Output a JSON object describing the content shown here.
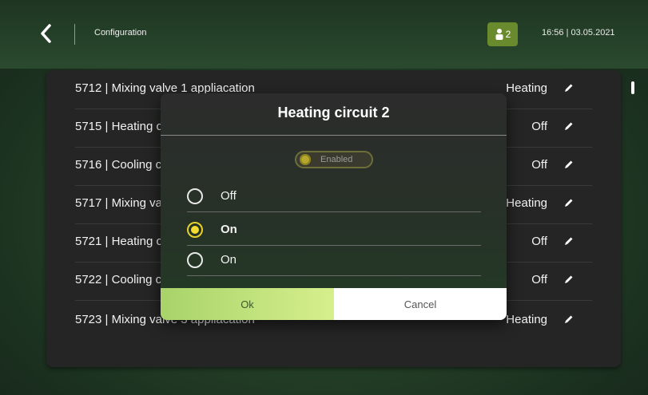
{
  "header": {
    "title": "Configuration",
    "user_count": "2",
    "datetime": "16:56 | 03.05.2021"
  },
  "list": {
    "rows": [
      {
        "label": "5712 | Mixing valve 1 appliacation",
        "value": "Heating"
      },
      {
        "label": "5715 | Heating circuit 2",
        "value": "Off"
      },
      {
        "label": "5716 | Cooling circuit 2",
        "value": "Off"
      },
      {
        "label": "5717 | Mixing valve 2 appliacation",
        "value": "Heating"
      },
      {
        "label": "5721 | Heating circuit 3",
        "value": "Off"
      },
      {
        "label": "5722 | Cooling circuit 3",
        "value": "Off"
      },
      {
        "label": "5723 | Mixing valve 3 appliacation",
        "value": "Heating"
      }
    ]
  },
  "dialog": {
    "title": "Heating circuit 2",
    "enabled_label": "Enabled",
    "options": [
      {
        "label": "Off",
        "selected": false
      },
      {
        "label": "On",
        "selected": true
      },
      {
        "label": "On",
        "selected": false
      }
    ],
    "ok_label": "Ok",
    "cancel_label": "Cancel"
  },
  "colors": {
    "accent_yellow": "#f2dd2e",
    "ok_button": "#c6e67e",
    "badge": "#6a8a2e"
  },
  "icons": [
    "back-arrow-icon",
    "user-icon",
    "edit-pencil-icon"
  ]
}
